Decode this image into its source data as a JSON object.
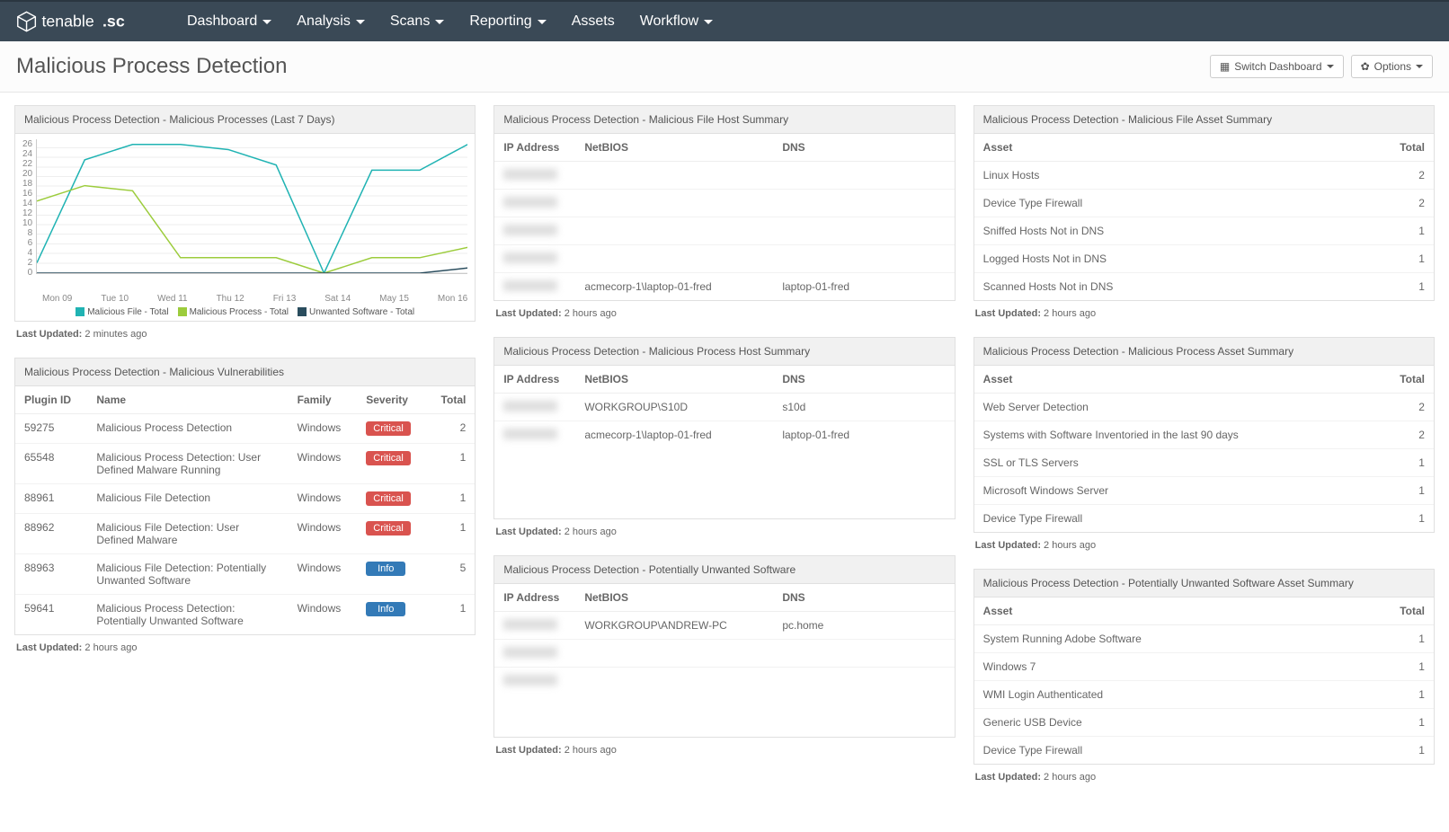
{
  "brand": "tenable.sc",
  "nav": [
    "Dashboard",
    "Analysis",
    "Scans",
    "Reporting",
    "Assets",
    "Workflow"
  ],
  "nav_has_caret": [
    true,
    true,
    true,
    true,
    false,
    true
  ],
  "page_title": "Malicious Process Detection",
  "buttons": {
    "switch": "Switch Dashboard",
    "options": "Options"
  },
  "chart_data": {
    "type": "line",
    "title": "Malicious Process Detection - Malicious Processes (Last 7 Days)",
    "categories": [
      "Mon 09",
      "Tue 10",
      "Wed 11",
      "Thu 12",
      "Fri 13",
      "Sat 14",
      "May 15",
      "Mon 16"
    ],
    "ylim": [
      0,
      26
    ],
    "yticks": [
      0,
      2,
      4,
      6,
      8,
      10,
      12,
      14,
      16,
      18,
      20,
      22,
      24,
      26
    ],
    "series": [
      {
        "name": "Malicious File - Total",
        "color": "#20b3b3",
        "values": [
          2,
          22,
          25,
          25,
          24,
          21,
          0,
          20,
          20,
          25
        ]
      },
      {
        "name": "Malicious Process - Total",
        "color": "#9ccc3c",
        "values": [
          14,
          17,
          16,
          3,
          3,
          3,
          0,
          3,
          3,
          5
        ]
      },
      {
        "name": "Unwanted Software - Total",
        "color": "#2a4d5e",
        "values": [
          0,
          0,
          0,
          0,
          0,
          0,
          0,
          0,
          0,
          1
        ]
      }
    ],
    "updated": "2 minutes ago"
  },
  "panels": {
    "vuln": {
      "title": "Malicious Process Detection - Malicious Vulnerabilities",
      "headers": [
        "Plugin ID",
        "Name",
        "Family",
        "Severity",
        "Total"
      ],
      "rows": [
        {
          "id": "59275",
          "name": "Malicious Process Detection",
          "family": "Windows",
          "sev": "Critical",
          "sevClass": "critical",
          "total": "2"
        },
        {
          "id": "65548",
          "name": "Malicious Process Detection: User Defined Malware Running",
          "family": "Windows",
          "sev": "Critical",
          "sevClass": "critical",
          "total": "1"
        },
        {
          "id": "88961",
          "name": "Malicious File Detection",
          "family": "Windows",
          "sev": "Critical",
          "sevClass": "critical",
          "total": "1"
        },
        {
          "id": "88962",
          "name": "Malicious File Detection: User Defined Malware",
          "family": "Windows",
          "sev": "Critical",
          "sevClass": "critical",
          "total": "1"
        },
        {
          "id": "88963",
          "name": "Malicious File Detection: Potentially Unwanted Software",
          "family": "Windows",
          "sev": "Info",
          "sevClass": "info",
          "total": "5"
        },
        {
          "id": "59641",
          "name": "Malicious Process Detection: Potentially Unwanted Software",
          "family": "Windows",
          "sev": "Info",
          "sevClass": "info",
          "total": "1"
        }
      ],
      "updated": "2 hours ago"
    },
    "file_host": {
      "title": "Malicious Process Detection - Malicious File Host Summary",
      "headers": [
        "IP Address",
        "NetBIOS",
        "DNS"
      ],
      "rows": [
        {
          "ip": "",
          "netbios": "",
          "dns": ""
        },
        {
          "ip": "",
          "netbios": "",
          "dns": ""
        },
        {
          "ip": "",
          "netbios": "",
          "dns": ""
        },
        {
          "ip": "",
          "netbios": "",
          "dns": ""
        },
        {
          "ip": "",
          "netbios": "acmecorp-1\\laptop-01-fred",
          "dns": "laptop-01-fred"
        }
      ],
      "updated": "2 hours ago"
    },
    "proc_host": {
      "title": "Malicious Process Detection - Malicious Process Host Summary",
      "headers": [
        "IP Address",
        "NetBIOS",
        "DNS"
      ],
      "rows": [
        {
          "ip": "",
          "netbios": "WORKGROUP\\S10D",
          "dns": "s10d"
        },
        {
          "ip": "",
          "netbios": "acmecorp-1\\laptop-01-fred",
          "dns": "laptop-01-fred"
        }
      ],
      "updated": "2 hours ago"
    },
    "unwanted": {
      "title": "Malicious Process Detection - Potentially Unwanted Software",
      "headers": [
        "IP Address",
        "NetBIOS",
        "DNS"
      ],
      "rows": [
        {
          "ip": "",
          "netbios": "WORKGROUP\\ANDREW-PC",
          "dns": "pc.home"
        },
        {
          "ip": "",
          "netbios": "",
          "dns": ""
        },
        {
          "ip": "",
          "netbios": "",
          "dns": ""
        }
      ],
      "updated": "2 hours ago"
    },
    "file_asset": {
      "title": "Malicious Process Detection - Malicious File Asset Summary",
      "headers": [
        "Asset",
        "Total"
      ],
      "rows": [
        {
          "asset": "Linux Hosts",
          "total": "2"
        },
        {
          "asset": "Device Type Firewall",
          "total": "2"
        },
        {
          "asset": "Sniffed Hosts Not in DNS",
          "total": "1"
        },
        {
          "asset": "Logged Hosts Not in DNS",
          "total": "1"
        },
        {
          "asset": "Scanned Hosts Not in DNS",
          "total": "1"
        }
      ],
      "updated": "2 hours ago"
    },
    "proc_asset": {
      "title": "Malicious Process Detection - Malicious Process Asset Summary",
      "headers": [
        "Asset",
        "Total"
      ],
      "rows": [
        {
          "asset": "Web Server Detection",
          "total": "2"
        },
        {
          "asset": "Systems with Software Inventoried in the last 90 days",
          "total": "2"
        },
        {
          "asset": "SSL or TLS Servers",
          "total": "1"
        },
        {
          "asset": "Microsoft Windows Server",
          "total": "1"
        },
        {
          "asset": "Device Type Firewall",
          "total": "1"
        }
      ],
      "updated": "2 hours ago"
    },
    "unwanted_asset": {
      "title": "Malicious Process Detection - Potentially Unwanted Software Asset Summary",
      "headers": [
        "Asset",
        "Total"
      ],
      "rows": [
        {
          "asset": "System Running Adobe Software",
          "total": "1"
        },
        {
          "asset": "Windows 7",
          "total": "1"
        },
        {
          "asset": "WMI Login Authenticated",
          "total": "1"
        },
        {
          "asset": "Generic USB Device",
          "total": "1"
        },
        {
          "asset": "Device Type Firewall",
          "total": "1"
        }
      ],
      "updated": "2 hours ago"
    }
  },
  "labels": {
    "last_updated": "Last Updated:"
  }
}
